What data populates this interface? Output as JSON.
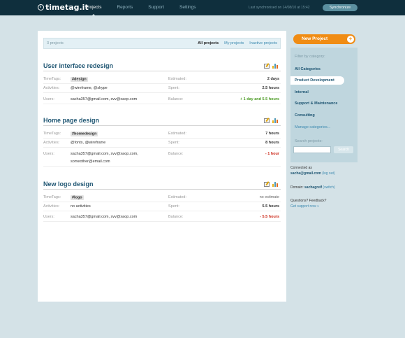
{
  "header": {
    "logo": "timetag.it",
    "nav": [
      "Projects",
      "Reports",
      "Support",
      "Settings"
    ],
    "sync_text": "Last synchronised on 14/08/10 at 15:42",
    "sync_button": "Synchronize"
  },
  "filter": {
    "count": "3 projects",
    "tabs": [
      "All projects",
      "My projects",
      "Inactive projects"
    ]
  },
  "labels": {
    "timetags": "TimeTags:",
    "activities": "Activities:",
    "users": "Users:",
    "estimated": "Estimated:",
    "spent": "Spent:",
    "balance": "Balance:"
  },
  "projects": [
    {
      "title": "User interface redesign",
      "timetag": "#design",
      "activities": "@wireframe, @skype",
      "users": "sacha357@gmail.com, svv@xaop.com",
      "estimated": "2 days",
      "spent": "2.5 hours",
      "balance": "+ 1 day and 5.5 hours"
    },
    {
      "title": "Home page design",
      "timetag": "#homedesign",
      "activities": "@fonts, @wireframe",
      "users": "sacha357@gmail.com, svv@xaop.com,",
      "users2": "someother@email.com",
      "estimated": "7 hours",
      "spent": "8 hours",
      "balance": "- 1 hour"
    },
    {
      "title": "New logo design",
      "timetag": "#logo",
      "activities": "no activities",
      "users": "sacha357@gmail.com, svv@xaop.com",
      "estimated": "no estimate",
      "spent": "5.5 hours",
      "balance": "- 5.5 hours"
    }
  ],
  "sidebar": {
    "new_project": "New Project",
    "filter_heading": "Filter by category:",
    "categories": [
      "All Categories",
      "Product Development",
      "Internal",
      "Support & Maintenance",
      "Consulting"
    ],
    "manage": "Manage categories...",
    "search_label": "Search projects:",
    "search_button": "Search",
    "connected_as": "Connected as",
    "email": "sacha@gmail.com",
    "logout": "(log out)",
    "domain_label": "Domain:",
    "domain": "sachagreif",
    "switch": "(switch)",
    "questions": "Questions? Feedback?",
    "support": "Get support now »"
  },
  "colors": {
    "topbar": "#0f2f3d",
    "accent_orange": "#f08c14",
    "title_blue": "#1e5572",
    "positive": "#4a9a22",
    "negative": "#cc2a1a"
  }
}
